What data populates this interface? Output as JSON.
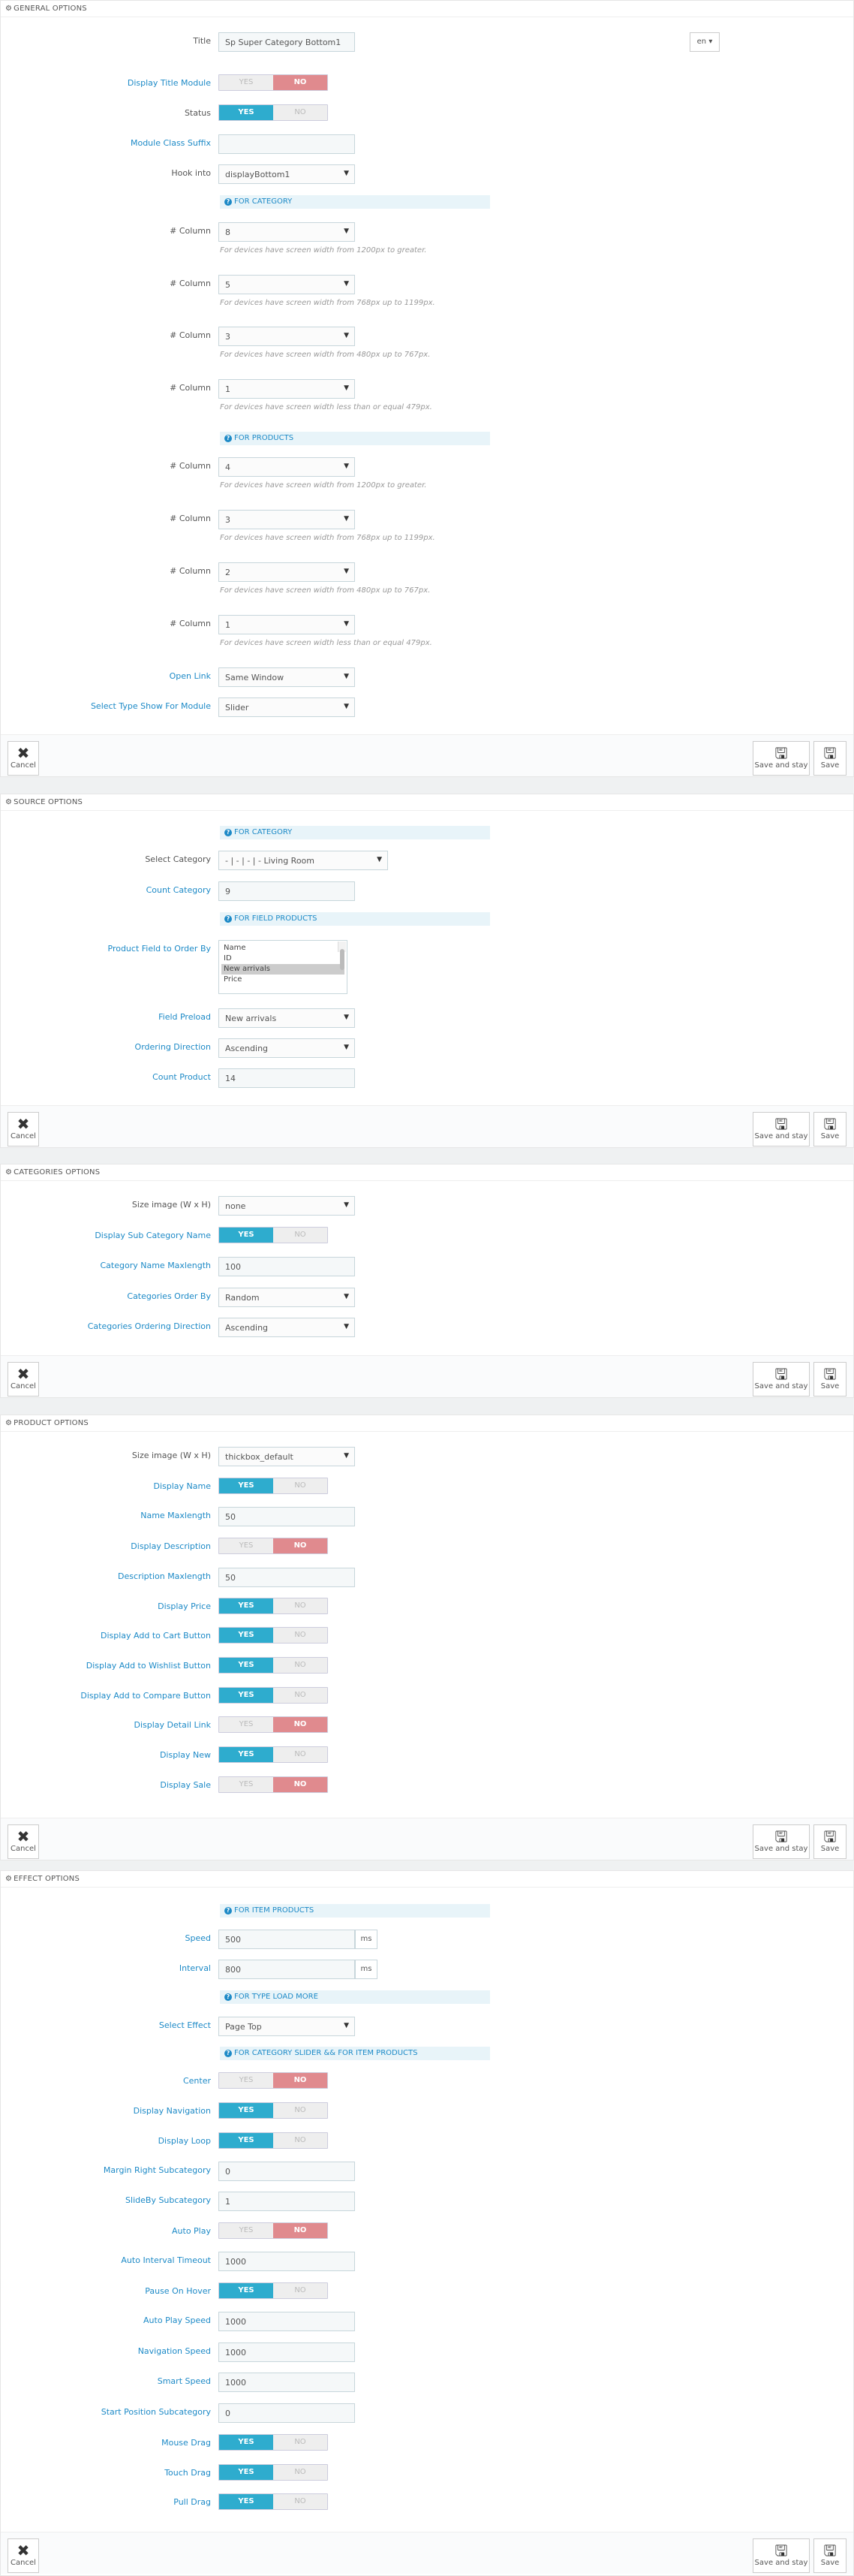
{
  "general": {
    "header": "GENERAL OPTIONS",
    "title_label": "Title",
    "title_value": "Sp Super Category Bottom1",
    "lang": "en",
    "display_title_label": "Display Title Module",
    "status_label": "Status",
    "class_suffix_label": "Module Class Suffix",
    "hook_label": "Hook into",
    "hook_value": "displayBottom1",
    "for_category": "FOR CATEGORY",
    "for_products": "FOR PRODUCTS",
    "column_label": "# Column",
    "cat_cols": [
      "8",
      "5",
      "3",
      "1"
    ],
    "prod_cols": [
      "4",
      "3",
      "2",
      "1"
    ],
    "helps": [
      "For devices have screen width from 1200px to greater.",
      "For devices have screen width from 768px up to 1199px.",
      "For devices have screen width from 480px up to 767px.",
      "For devices have screen width less than or equal 479px."
    ],
    "open_link_label": "Open Link",
    "open_link_value": "Same Window",
    "select_type_label": "Select Type Show For Module",
    "select_type_value": "Slider"
  },
  "source": {
    "header": "SOURCE OPTIONS",
    "for_category": "FOR CATEGORY",
    "select_category_label": "Select Category",
    "select_category_value": "- | - | - | - Living Room",
    "count_category_label": "Count Category",
    "count_category_value": "9",
    "for_field_products": "FOR FIELD PRODUCTS",
    "product_field_label": "Product Field to Order By",
    "product_field_options": [
      "Name",
      "ID",
      "New arrivals",
      "Price"
    ],
    "field_preload_label": "Field Preload",
    "field_preload_value": "New arrivals",
    "ordering_direction_label": "Ordering Direction",
    "ordering_direction_value": "Ascending",
    "count_product_label": "Count Product",
    "count_product_value": "14"
  },
  "categories": {
    "header": "CATEGORIES OPTIONS",
    "size_image_label": "Size image (W x H)",
    "size_image_value": "none",
    "display_sub_label": "Display Sub Category Name",
    "name_maxlength_label": "Category Name Maxlength",
    "name_maxlength_value": "100",
    "order_by_label": "Categories Order By",
    "order_by_value": "Random",
    "ordering_direction_label": "Categories Ordering Direction",
    "ordering_direction_value": "Ascending"
  },
  "product": {
    "header": "PRODUCT OPTIONS",
    "size_image_label": "Size image (W x H)",
    "size_image_value": "thickbox_default",
    "display_name_label": "Display Name",
    "name_maxlength_label": "Name Maxlength",
    "name_maxlength_value": "50",
    "display_description_label": "Display Description",
    "description_maxlength_label": "Description Maxlength",
    "description_maxlength_value": "50",
    "display_price_label": "Display Price",
    "add_cart_label": "Display Add to Cart Button",
    "add_wishlist_label": "Display Add to Wishlist Button",
    "add_compare_label": "Display Add to Compare Button",
    "detail_link_label": "Display Detail Link",
    "display_new_label": "Display New",
    "display_sale_label": "Display Sale"
  },
  "effect": {
    "header": "EFFECT OPTIONS",
    "for_item_products": "FOR ITEM PRODUCTS",
    "speed_label": "Speed",
    "speed_value": "500",
    "interval_label": "Interval",
    "interval_value": "800",
    "unit": "ms",
    "for_type_load_more": "FOR TYPE LOAD MORE",
    "select_effect_label": "Select Effect",
    "select_effect_value": "Page Top",
    "for_category_slider": "FOR CATEGORY SLIDER && FOR ITEM PRODUCTS",
    "center_label": "Center",
    "display_navigation_label": "Display Navigation",
    "display_loop_label": "Display Loop",
    "margin_right_label": "Margin Right Subcategory",
    "margin_right_value": "0",
    "slideby_label": "SlideBy Subcategory",
    "slideby_value": "1",
    "auto_play_label": "Auto Play",
    "auto_interval_label": "Auto Interval Timeout",
    "auto_interval_value": "1000",
    "pause_hover_label": "Pause On Hover",
    "auto_play_speed_label": "Auto Play Speed",
    "auto_play_speed_value": "1000",
    "navigation_speed_label": "Navigation Speed",
    "navigation_speed_value": "1000",
    "smart_speed_label": "Smart Speed",
    "smart_speed_value": "1000",
    "start_position_label": "Start Position Subcategory",
    "start_position_value": "0",
    "mouse_drag_label": "Mouse Drag",
    "touch_drag_label": "Touch Drag",
    "pull_drag_label": "Pull Drag"
  },
  "toggle": {
    "yes": "YES",
    "no": "NO"
  },
  "footer": {
    "cancel": "Cancel",
    "save_stay": "Save and stay",
    "save": "Save"
  }
}
